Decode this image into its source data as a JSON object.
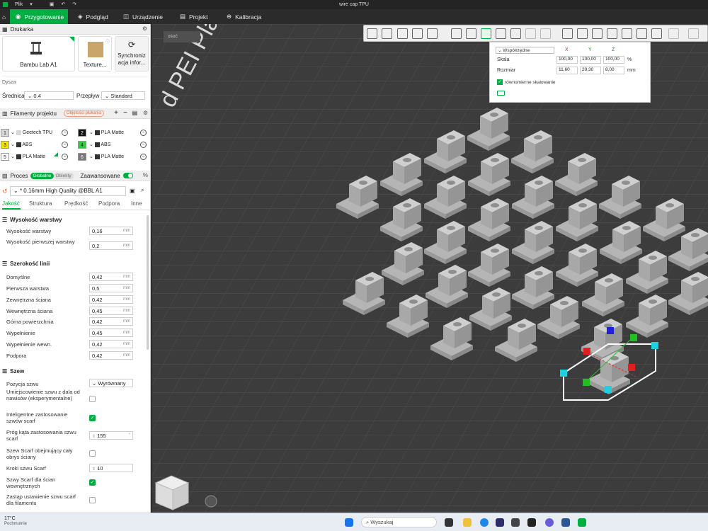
{
  "titlebar": {
    "menu_label": "Plik",
    "title": "wire cap TPU"
  },
  "topnav": {
    "tabs": [
      {
        "label": "Przygotowanie",
        "active": true
      },
      {
        "label": "Podgląd",
        "active": false
      },
      {
        "label": "Urządzenie",
        "active": false
      },
      {
        "label": "Projekt",
        "active": false
      },
      {
        "label": "Kalibracja",
        "active": false
      }
    ]
  },
  "printer": {
    "section_title": "Drukarka",
    "name": "Bambu Lab A1",
    "plate": "Texture...",
    "sync_label_1": "Synchroniz",
    "sync_label_2": "acja infor...",
    "nozzle_label": "Dysza",
    "diameter_label": "Średnica",
    "diameter_value": "0.4",
    "flow_label": "Przepływ",
    "flow_value": "Standard"
  },
  "filaments": {
    "section_title": "Filamenty projektu",
    "flush_button": "Objętości płukania",
    "items": [
      {
        "slot": "1",
        "name": "Geetech TPU",
        "color": "#d8d8d8"
      },
      {
        "slot": "2",
        "name": "PLA Matte",
        "color": "#111111"
      },
      {
        "slot": "3",
        "name": "ABS",
        "color": "#f5e400"
      },
      {
        "slot": "4",
        "name": "ABS",
        "color": "#2ecc40"
      },
      {
        "slot": "5",
        "name": "PLA Matte",
        "color": "#ffffff"
      },
      {
        "slot": "6",
        "name": "PLA Matte",
        "color": "#777777"
      }
    ]
  },
  "process": {
    "label": "Proces",
    "toggle_global": "Globalne",
    "toggle_objects": "Obiekty",
    "advanced_label": "Zaawansowane",
    "advanced_on": true,
    "preset": "* 0.16mm High Quality @BBL A1",
    "subtabs": [
      "Jakość",
      "Struktura",
      "Prędkość",
      "Podpora",
      "Inne"
    ],
    "active_subtab": "Jakość"
  },
  "settings": {
    "layer_height": {
      "title": "Wysokość warstwy",
      "rows": [
        {
          "label": "Wysokość warstwy",
          "value": "0,16",
          "unit": "mm"
        },
        {
          "label": "Wysokość pierwszej warstwy",
          "value": "0,2",
          "unit": "mm"
        }
      ]
    },
    "line_width": {
      "title": "Szerokość linii",
      "rows": [
        {
          "label": "Domyślne",
          "value": "0,42",
          "unit": "mm"
        },
        {
          "label": "Pierwsza warstwa",
          "value": "0,5",
          "unit": "mm"
        },
        {
          "label": "Zewnętrzna ściana",
          "value": "0,42",
          "unit": "mm"
        },
        {
          "label": "Wewnętrzna ściana",
          "value": "0,45",
          "unit": "mm"
        },
        {
          "label": "Górna powierzchnia",
          "value": "0,42",
          "unit": "mm"
        },
        {
          "label": "Wypełnienie",
          "value": "0,45",
          "unit": "mm"
        },
        {
          "label": "Wypełnienie wewn.",
          "value": "0,42",
          "unit": "mm"
        },
        {
          "label": "Podpora",
          "value": "0,42",
          "unit": "mm"
        }
      ]
    },
    "seam": {
      "title": "Szew",
      "position_label": "Pozycja szwu",
      "position_value": "Wyrównany",
      "overhang_label": "Umiejscowienie szwu z dala od nawisów (eksperymentalne)",
      "overhang_checked": false,
      "scarf_label": "Inteligentne zastosowanie szwów scarf",
      "scarf_checked": true,
      "angle_label": "Próg kąta zastosowania szwu scarf",
      "angle_value": "155",
      "angle_unit": "°",
      "full_label": "Szew Scarf obejmujący cały obrys ściany",
      "full_checked": false,
      "steps_label": "Kroki szwu Scarf",
      "steps_value": "10",
      "inner_label": "Szwy Scarf dla ścian wewnętrznych",
      "inner_checked": true,
      "replace_label": "Zastąp ustawienie szwu scarf dla filamentu",
      "replace_checked": false
    }
  },
  "viewport": {
    "plate_text": "d PEI Plate",
    "tag": "ośoć"
  },
  "coords": {
    "dropdown": "Współrzędne",
    "x": "X",
    "y": "Y",
    "z": "Z",
    "scale_label": "Skala",
    "scale": [
      "100,00",
      "100,00",
      "100,00"
    ],
    "scale_unit": "%",
    "size_label": "Rozmiar",
    "size": [
      "11,60",
      "20,30",
      "8,00"
    ],
    "size_unit": "mm",
    "uniform_label": "równomierne skalowanie",
    "uniform_checked": true
  },
  "taskbar": {
    "temp": "17°C",
    "weather": "Pochmurnie",
    "search": "Wyszukaj"
  },
  "colors": {
    "accent": "#00ae42",
    "axis_x": "#e02020",
    "axis_y": "#20c020",
    "axis_z": "#2020e0"
  }
}
